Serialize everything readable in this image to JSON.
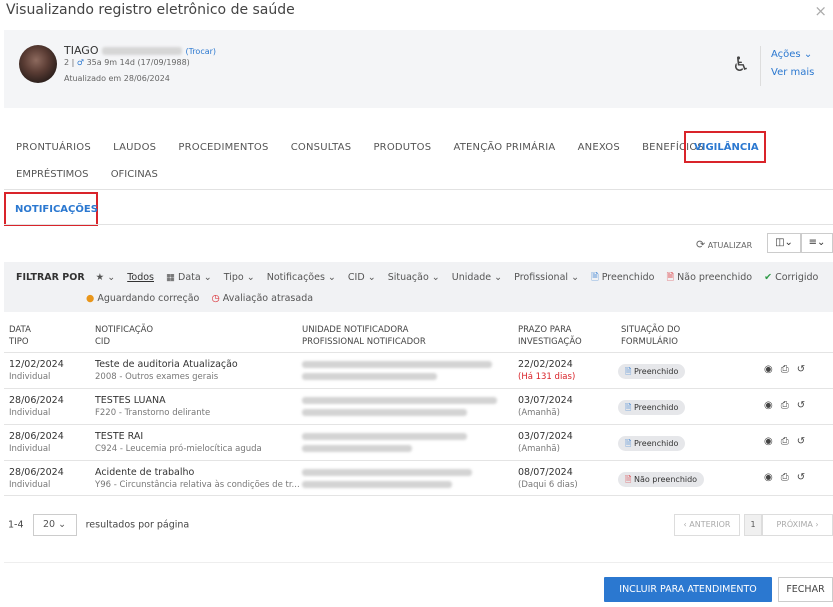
{
  "header": {
    "title": "Visualizando registro eletrônico de saúde",
    "close": "×"
  },
  "patient": {
    "name": "TIAGO",
    "change": "(Trocar)",
    "info_prefix": "2 |",
    "sex_icon": "♂",
    "info": "35a 9m 14d (17/09/1988)",
    "updated": "Atualizado em 28/06/2024",
    "actions": "Ações ⌄",
    "see_more": "Ver mais"
  },
  "tabs": {
    "row1": [
      "PRONTUÁRIOS",
      "LAUDOS",
      "PROCEDIMENTOS",
      "CONSULTAS",
      "PRODUTOS",
      "ATENÇÃO PRIMÁRIA",
      "ANEXOS",
      "BENEFÍCIOS"
    ],
    "active": "VIGILÂNCIA",
    "row2": [
      "EMPRÉSTIMOS",
      "OFICINAS"
    ],
    "subtab": "NOTIFICAÇÕES"
  },
  "toolbar": {
    "refresh": "ATUALIZAR",
    "view": "◫⌄",
    "menu": "≡⌄"
  },
  "filters": {
    "label": "FILTRAR POR",
    "star": "★ ⌄",
    "all": "Todos",
    "items": [
      "Data ⌄",
      "Tipo ⌄",
      "Notificações ⌄",
      "CID ⌄",
      "Situação ⌄",
      "Unidade ⌄",
      "Profissional ⌄"
    ],
    "filled": "Preenchido",
    "not_filled": "Não preenchido",
    "corrected": "Corrigido",
    "awaiting": "Aguardando correção",
    "late": "Avaliação atrasada"
  },
  "table": {
    "headers": {
      "date": "DATA",
      "type": "TIPO",
      "notification": "NOTIFICAÇÃO",
      "cid": "CID",
      "unit": "UNIDADE NOTIFICADORA",
      "prof": "PROFISSIONAL NOTIFICADOR",
      "deadline": "PRAZO PARA",
      "investigation": "INVESTIGAÇÃO",
      "status": "SITUAÇÃO DO",
      "form": "FORMULÁRIO"
    },
    "rows": [
      {
        "date": "12/02/2024",
        "type": "Individual",
        "title": "Teste de auditoria Atualização",
        "cid": "2008 - Outros exames gerais",
        "deadline": "22/02/2024",
        "deadline_note": "(Há 131 dias)",
        "status": "Preenchido"
      },
      {
        "date": "28/06/2024",
        "type": "Individual",
        "title": "TESTES LUANA",
        "cid": "F220 - Transtorno delirante",
        "deadline": "03/07/2024",
        "deadline_note": "(Amanhã)",
        "status": "Preenchido"
      },
      {
        "date": "28/06/2024",
        "type": "Individual",
        "title": "TESTE RAI",
        "cid": "C924 - Leucemia pró-mielocítica aguda",
        "deadline": "03/07/2024",
        "deadline_note": "(Amanhã)",
        "status": "Preenchido"
      },
      {
        "date": "28/06/2024",
        "type": "Individual",
        "title": "Acidente de trabalho",
        "cid": "Y96 - Circunstância relativa às condições de tr...",
        "deadline": "08/07/2024",
        "deadline_note": "(Daqui 6 dias)",
        "status": "Não preenchido"
      }
    ]
  },
  "pagination": {
    "range": "1-4",
    "per_page": "20 ⌄",
    "per_page_label": "resultados por página",
    "prev": "‹ ANTERIOR",
    "page": "1",
    "next": "PRÓXIMA ›"
  },
  "footer": {
    "include": "INCLUIR PARA ATENDIMENTO",
    "close": "FECHAR"
  }
}
